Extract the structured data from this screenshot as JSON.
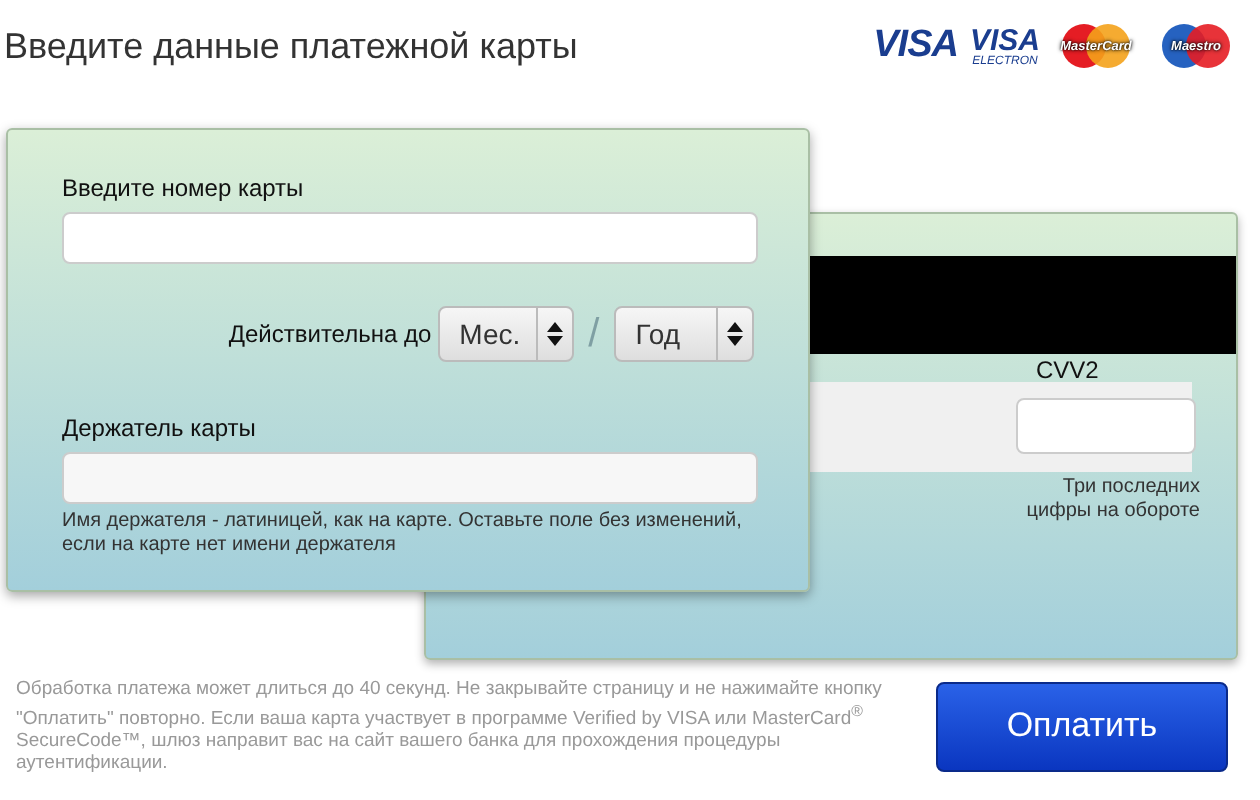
{
  "header": {
    "title": "Введите данные платежной карты",
    "logos": [
      {
        "kind": "visa",
        "text": "VISA"
      },
      {
        "kind": "visa_electron",
        "text": "VISA",
        "subtext": "ELECTRON"
      },
      {
        "kind": "mastercard",
        "text": "MasterCard"
      },
      {
        "kind": "maestro",
        "text": "Maestro"
      }
    ]
  },
  "front": {
    "number_label": "Введите номер карты",
    "expiry_label": "Действительна до",
    "month_placeholder": "Мес.",
    "separator": "/",
    "year_placeholder": "Год",
    "holder_label": "Держатель карты",
    "holder_hint": "Имя держателя - латиницей, как на карте. Оставьте поле без изменений, если на карте нет имени держателя"
  },
  "back": {
    "cvv_label": "CVV2",
    "cvv_hint": "Три последних цифры на обороте"
  },
  "footer": {
    "note": "Обработка платежа может длиться до 40 секунд. Не закрывайте страницу и не нажимайте кнопку \"Оплатить\" повторно. Если ваша карта участвует в программе Verified by VISA или MasterCard$^{®}$ SecureCode™, шлюз направит вас на сайт вашего банка для прохождения процедуры аутентификации.",
    "pay_button": "Оплатить"
  }
}
